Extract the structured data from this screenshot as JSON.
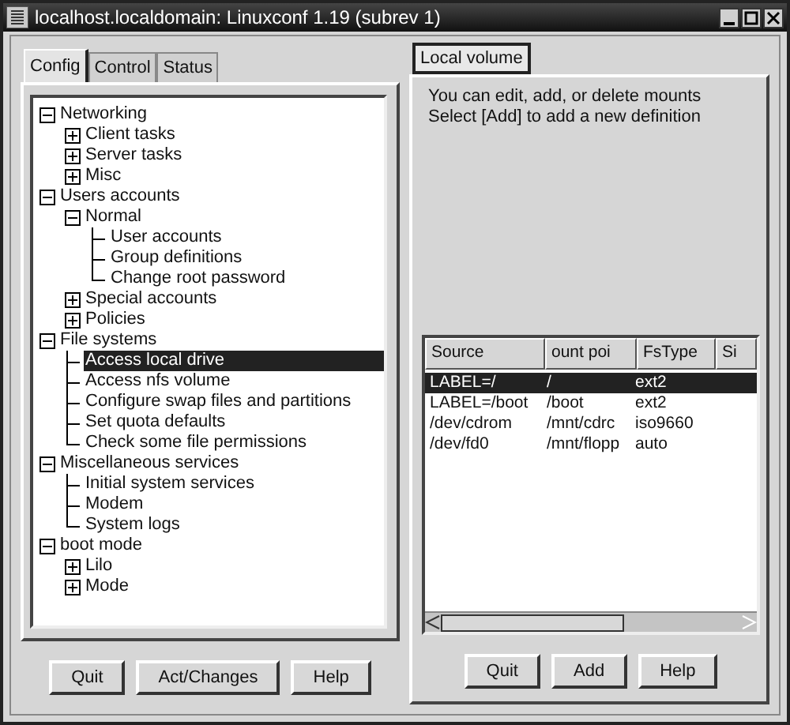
{
  "window": {
    "title": "localhost.localdomain: Linuxconf 1.19 (subrev 1)"
  },
  "tabs": [
    {
      "label": "Config",
      "selected": true
    },
    {
      "label": "Control",
      "selected": false
    },
    {
      "label": "Status",
      "selected": false
    }
  ],
  "tree": [
    {
      "label": "Networking",
      "kind": "folder",
      "expanded": true,
      "selected": false,
      "children": [
        {
          "label": "Client tasks",
          "kind": "folder",
          "expanded": false,
          "selected": false
        },
        {
          "label": "Server tasks",
          "kind": "folder",
          "expanded": false,
          "selected": false
        },
        {
          "label": "Misc",
          "kind": "folder",
          "expanded": false,
          "selected": false
        }
      ]
    },
    {
      "label": "Users accounts",
      "kind": "folder",
      "expanded": true,
      "selected": false,
      "children": [
        {
          "label": "Normal",
          "kind": "folder",
          "expanded": true,
          "selected": false,
          "children": [
            {
              "label": "User accounts",
              "kind": "leaf",
              "selected": false
            },
            {
              "label": "Group definitions",
              "kind": "leaf",
              "selected": false
            },
            {
              "label": "Change root password",
              "kind": "leaf",
              "selected": false
            }
          ]
        },
        {
          "label": "Special accounts",
          "kind": "folder",
          "expanded": false,
          "selected": false
        },
        {
          "label": "Policies",
          "kind": "folder",
          "expanded": false,
          "selected": false
        }
      ]
    },
    {
      "label": "File systems",
      "kind": "folder",
      "expanded": true,
      "selected": false,
      "children": [
        {
          "label": "Access local drive",
          "kind": "leaf",
          "selected": true
        },
        {
          "label": "Access nfs volume",
          "kind": "leaf",
          "selected": false
        },
        {
          "label": "Configure swap files and partitions",
          "kind": "leaf",
          "selected": false
        },
        {
          "label": "Set quota defaults",
          "kind": "leaf",
          "selected": false
        },
        {
          "label": "Check some file permissions",
          "kind": "leaf",
          "selected": false
        }
      ]
    },
    {
      "label": "Miscellaneous services",
      "kind": "folder",
      "expanded": true,
      "selected": false,
      "children": [
        {
          "label": "Initial system services",
          "kind": "leaf",
          "selected": false
        },
        {
          "label": "Modem",
          "kind": "leaf",
          "selected": false
        },
        {
          "label": "System logs",
          "kind": "leaf",
          "selected": false
        }
      ]
    },
    {
      "label": "boot mode",
      "kind": "folder",
      "expanded": true,
      "selected": false,
      "children": [
        {
          "label": "Lilo",
          "kind": "folder",
          "expanded": false,
          "selected": false
        },
        {
          "label": "Mode",
          "kind": "folder",
          "expanded": false,
          "selected": false
        }
      ]
    }
  ],
  "left_buttons": [
    "Quit",
    "Act/Changes",
    "Help"
  ],
  "right_tab": {
    "label": "Local volume",
    "selected": true
  },
  "info_lines": [
    "You can edit, add, or delete mounts",
    "Select [Add] to add a new definition"
  ],
  "table": {
    "columns": [
      "Source",
      "ount poi",
      "FsType",
      "Si"
    ],
    "rows": [
      {
        "cells": [
          "LABEL=/",
          "/",
          "ext2"
        ],
        "selected": true
      },
      {
        "cells": [
          "LABEL=/boot",
          "/boot",
          "ext2"
        ],
        "selected": false
      },
      {
        "cells": [
          "/dev/cdrom",
          "/mnt/cdrc",
          "iso9660"
        ],
        "selected": false
      },
      {
        "cells": [
          "/dev/fd0",
          "/mnt/flopp",
          "auto"
        ],
        "selected": false
      }
    ]
  },
  "right_buttons": [
    "Quit",
    "Add",
    "Help"
  ]
}
